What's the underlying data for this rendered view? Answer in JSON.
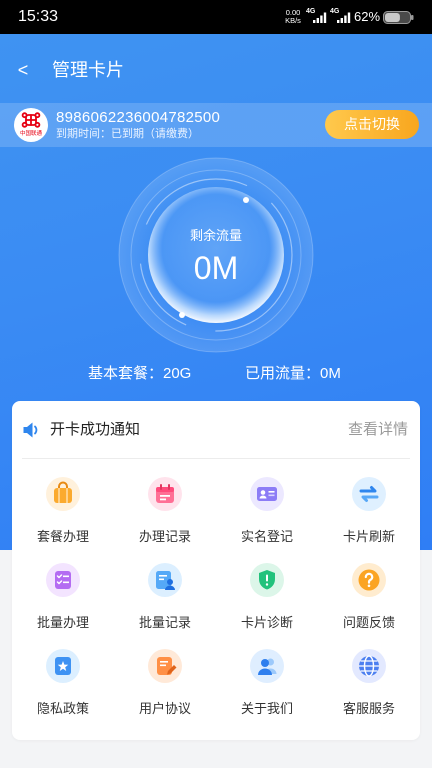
{
  "status_bar": {
    "time": "15:33",
    "net_speed": "0.00",
    "net_unit": "KB/s",
    "network_1": "4G",
    "network_2": "4G",
    "battery": "62%",
    "battery_level": 0.62
  },
  "header": {
    "back_label": "<",
    "title": "管理卡片"
  },
  "card": {
    "logo_text": "中国联通",
    "number": "8986062236004782500",
    "expiry": "到期时间：已到期（请缴费）",
    "switch_label": "点击切换"
  },
  "gauge": {
    "label": "剩余流量",
    "value": "0M"
  },
  "stats": {
    "plan": "基本套餐：20G",
    "used": "已用流量：0M"
  },
  "notice": {
    "icon": "speaker-icon",
    "title": "开卡成功通知",
    "detail_label": "查看详情"
  },
  "grid": {
    "items": [
      {
        "label": "套餐办理",
        "icon": "shopping-bag-icon"
      },
      {
        "label": "办理记录",
        "icon": "calendar-icon"
      },
      {
        "label": "实名登记",
        "icon": "id-card-icon"
      },
      {
        "label": "卡片刷新",
        "icon": "refresh-swap-icon"
      },
      {
        "label": "批量办理",
        "icon": "checklist-icon"
      },
      {
        "label": "批量记录",
        "icon": "document-person-icon"
      },
      {
        "label": "卡片诊断",
        "icon": "shield-alert-icon"
      },
      {
        "label": "问题反馈",
        "icon": "question-icon"
      },
      {
        "label": "隐私政策",
        "icon": "star-document-icon"
      },
      {
        "label": "用户协议",
        "icon": "pen-document-icon"
      },
      {
        "label": "关于我们",
        "icon": "people-icon"
      },
      {
        "label": "客服服务",
        "icon": "globe-icon"
      }
    ]
  },
  "colors": {
    "primary": "#3a8bf3",
    "switch_button": "#f8a61e",
    "page_background": "#f3f4f6",
    "unicom_red": "#e60012"
  }
}
